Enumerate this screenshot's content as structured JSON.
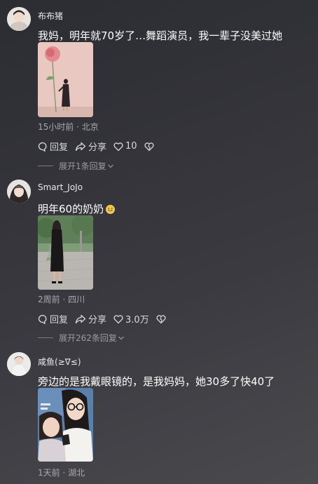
{
  "comments": [
    {
      "username": "布布猪",
      "text": "我妈，明年就70岁了…舞蹈演员，我一辈子没美过她",
      "meta": "15小时前 · 北京",
      "reply_label": "回复",
      "share_label": "分享",
      "like_count": "10",
      "expand_label": "展开1条回复"
    },
    {
      "username": "Smart_JoJo",
      "text": "明年60的奶奶",
      "emoji": "grinning-sweat-emoji",
      "meta": "2周前 · 四川",
      "reply_label": "回复",
      "share_label": "分享",
      "like_count": "3.0万",
      "expand_label": "展开262条回复"
    },
    {
      "username": "咸鱼(≥∇≤)",
      "text": "旁边的是我戴眼镜的，是我妈妈，她30多了快40了",
      "meta": "1天前 · 湖北"
    }
  ]
}
